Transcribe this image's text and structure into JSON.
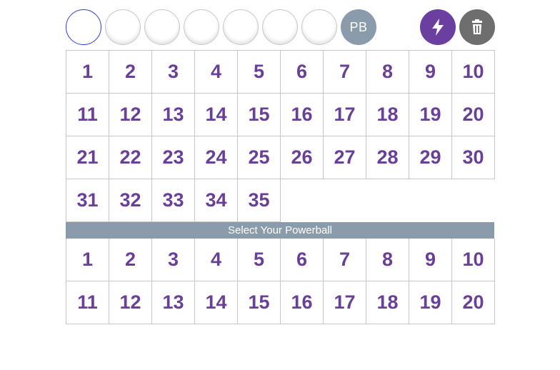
{
  "selection": {
    "balls": [
      "",
      "",
      "",
      "",
      "",
      "",
      ""
    ],
    "powerball_label": "PB"
  },
  "actions": {
    "quick_pick_icon": "lightning-bolt-icon",
    "clear_icon": "trash-icon"
  },
  "main_numbers": [
    1,
    2,
    3,
    4,
    5,
    6,
    7,
    8,
    9,
    10,
    11,
    12,
    13,
    14,
    15,
    16,
    17,
    18,
    19,
    20,
    21,
    22,
    23,
    24,
    25,
    26,
    27,
    28,
    29,
    30,
    31,
    32,
    33,
    34,
    35
  ],
  "powerball_section": {
    "header": "Select Your Powerball",
    "numbers": [
      1,
      2,
      3,
      4,
      5,
      6,
      7,
      8,
      9,
      10,
      11,
      12,
      13,
      14,
      15,
      16,
      17,
      18,
      19,
      20
    ]
  },
  "colors": {
    "number_text": "#6a3f98",
    "header_bg": "#8a9bab",
    "quick_pick_bg": "#6b3fa0",
    "clear_bg": "#6e6e6e",
    "active_ball_border": "#2f3fd8"
  }
}
